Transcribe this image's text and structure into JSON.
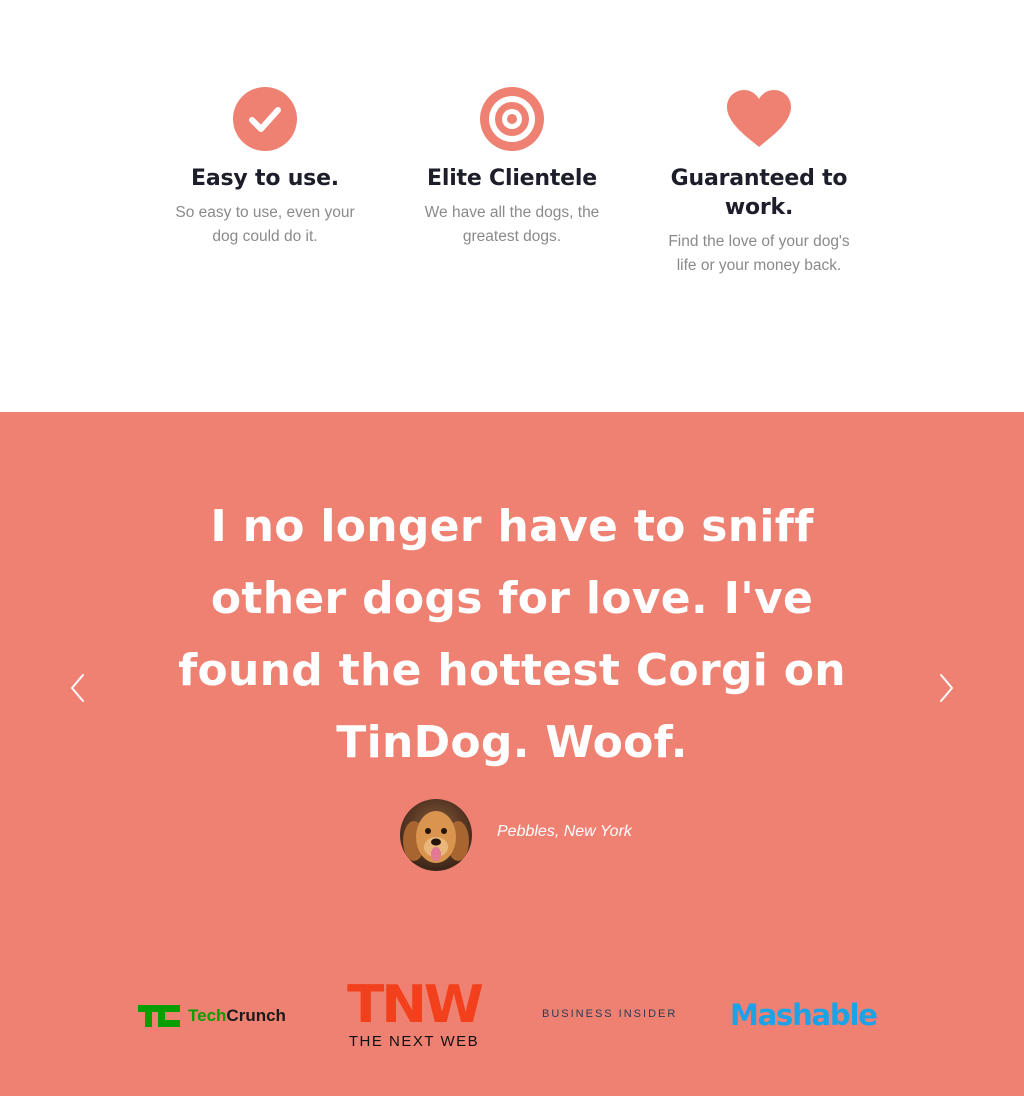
{
  "features": [
    {
      "icon": "check-circle-icon",
      "title": "Easy to use.",
      "text": "So easy to use, even your dog could do it."
    },
    {
      "icon": "bullseye-icon",
      "title": "Elite Clientele",
      "text": "We have all the dogs, the greatest dogs."
    },
    {
      "icon": "heart-icon",
      "title": "Guaranteed to work.",
      "text": "Find the love of your dog's life or your money back."
    }
  ],
  "testimonial": {
    "quote": "I no longer have to sniff other dogs for love. I've found the hottest Corgi on TinDog. Woof.",
    "author": "Pebbles, New York"
  },
  "carousel": {
    "prev_icon": "chevron-left-icon",
    "next_icon": "chevron-right-icon"
  },
  "press": {
    "techcrunch_mark": "TC",
    "techcrunch_a": "Tech",
    "techcrunch_b": "Crunch",
    "tnw_big": "TNW",
    "tnw_small": "THE NEXT WEB",
    "business_insider": "BUSINESS INSIDER",
    "mashable": "Mashable"
  },
  "colors": {
    "accent": "#ef8172",
    "heading": "#1e1e2b",
    "muted": "#8a8a8a"
  }
}
